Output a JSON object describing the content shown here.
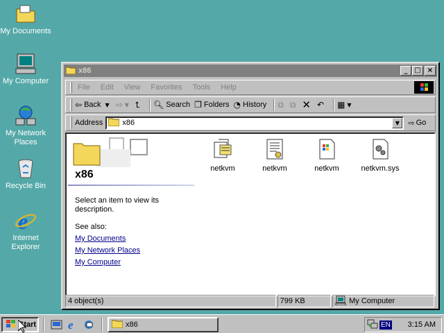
{
  "desktop": {
    "icons": [
      {
        "label": "My Documents",
        "icon": "my-documents-icon"
      },
      {
        "label": "My Computer",
        "icon": "my-computer-icon"
      },
      {
        "label": "My Network Places",
        "icon": "network-places-icon"
      },
      {
        "label": "Recycle Bin",
        "icon": "recycle-bin-icon"
      },
      {
        "label": "Internet Explorer",
        "icon": "internet-explorer-icon"
      }
    ]
  },
  "window": {
    "title": "x86",
    "buttons": {
      "minimize": "_",
      "maximize": "□",
      "close": "×"
    },
    "menu": [
      "File",
      "Edit",
      "View",
      "Favorites",
      "Tools",
      "Help"
    ],
    "toolbar": {
      "back": "Back",
      "search": "Search",
      "folders": "Folders",
      "history": "History"
    },
    "address": {
      "label": "Address",
      "value": "x86",
      "go": "Go"
    },
    "left_pane": {
      "folder_name": "x86",
      "description": "Select an item to view its description.",
      "see_also": "See also:",
      "links": [
        "My Documents",
        "My Network Places",
        "My Computer"
      ]
    },
    "files": [
      {
        "name": "netkvm",
        "icon": "setup-info-icon"
      },
      {
        "name": "netkvm",
        "icon": "security-catalog-icon"
      },
      {
        "name": "netkvm",
        "icon": "program-database-icon"
      },
      {
        "name": "netkvm.sys",
        "icon": "system-file-icon"
      }
    ],
    "status": {
      "objects": "4 object(s)",
      "size": "799 KB",
      "zone": "My Computer"
    }
  },
  "taskbar": {
    "start": "Start",
    "task": "x86",
    "lang": "EN",
    "clock": "3:15 AM"
  },
  "colors": {
    "desktop": "#55a8a8",
    "face": "#c0c0c0",
    "title_inactive": "#808080",
    "link": "#00008b"
  }
}
